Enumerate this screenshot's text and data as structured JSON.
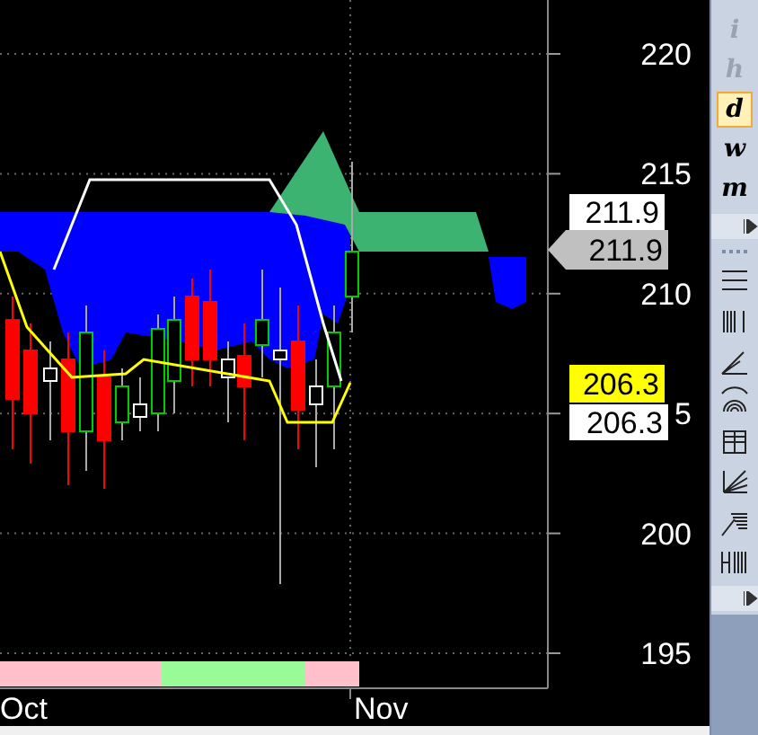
{
  "y_axis": {
    "labels": [
      "220",
      "215",
      "210",
      "5",
      "200",
      "195"
    ]
  },
  "price_tags": [
    {
      "text": "211.9",
      "kind": "box",
      "color": "#ffffff"
    },
    {
      "text": "211.9",
      "kind": "arrow",
      "color": "#c0c0c0"
    },
    {
      "text": "206.3",
      "kind": "box",
      "color": "#ffff00"
    },
    {
      "text": "206.3",
      "kind": "box",
      "color": "#ffffff"
    }
  ],
  "band": [
    {
      "color": "#ffc0cb"
    },
    {
      "color": "#98fb98"
    },
    {
      "color": "#ffc0cb"
    }
  ],
  "x_axis": {
    "labels": [
      "Oct",
      "Nov"
    ]
  },
  "toolbar": {
    "timeframes": [
      {
        "label": "i",
        "disabled": true,
        "selected": false
      },
      {
        "label": "h",
        "disabled": true,
        "selected": false
      },
      {
        "label": "d",
        "disabled": false,
        "selected": true
      },
      {
        "label": "w",
        "disabled": false,
        "selected": false
      },
      {
        "label": "m",
        "disabled": false,
        "selected": false
      }
    ]
  }
}
